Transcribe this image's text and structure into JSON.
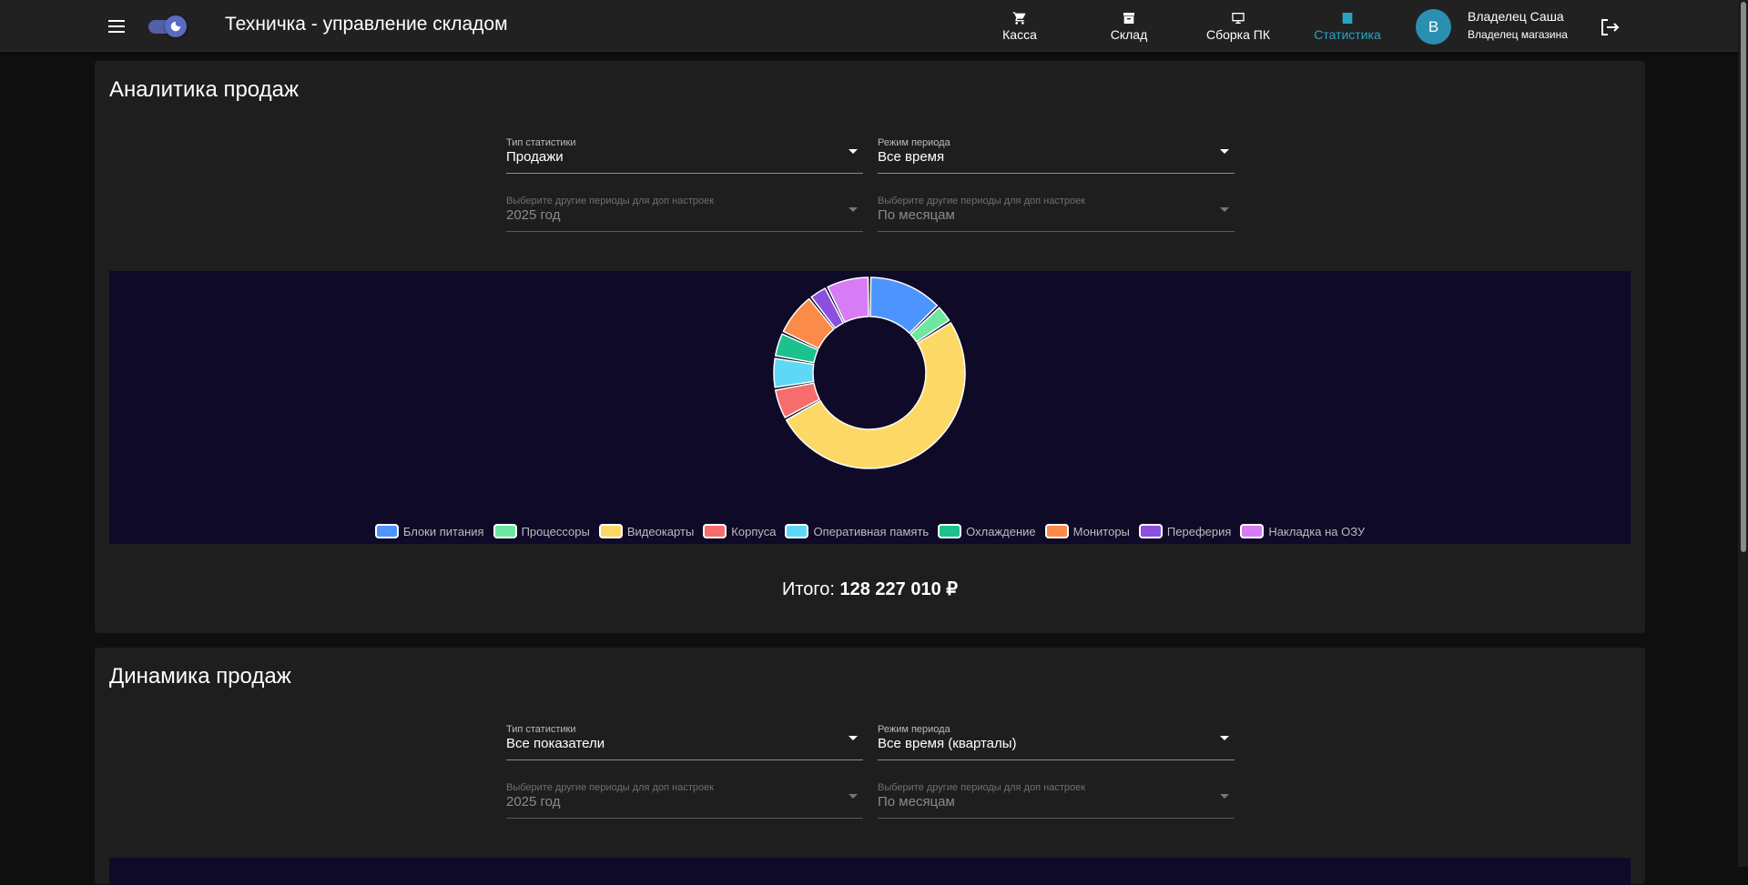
{
  "header": {
    "app_title": "Техничка - управление складом",
    "nav": [
      {
        "label": "Касса",
        "icon": "cart-icon"
      },
      {
        "label": "Склад",
        "icon": "archive-icon"
      },
      {
        "label": "Сборка ПК",
        "icon": "monitor-icon"
      },
      {
        "label": "Статистика",
        "icon": "chart-icon",
        "active": true
      }
    ],
    "user": {
      "initial": "В",
      "name": "Владелец Саша",
      "role": "Владелец магазина"
    },
    "accent_color": "#29a3c5"
  },
  "analytics": {
    "title": "Аналитика продаж",
    "filters": [
      {
        "label": "Тип статистики",
        "value": "Продажи"
      },
      {
        "label": "Режим периода",
        "value": "Все время"
      },
      {
        "label": "Выберите другие периоды для доп настроек",
        "value": "2025 год"
      },
      {
        "label": "Выберите другие периоды для доп настроек",
        "value": "По месяцам"
      }
    ],
    "total_label": "Итого:",
    "total_value": "128 227 010 ₽"
  },
  "dynamics": {
    "title": "Динамика продаж",
    "filters": [
      {
        "label": "Тип статистики",
        "value": "Все показатели"
      },
      {
        "label": "Режим периода",
        "value": "Все время (кварталы)"
      },
      {
        "label": "Выберите другие периоды для доп настроек",
        "value": "2025 год"
      },
      {
        "label": "Выберите другие периоды для доп настроек",
        "value": "По месяцам"
      }
    ]
  },
  "chart_data": {
    "type": "pie",
    "title": "",
    "legend_position": "bottom",
    "categories": [
      "Блоки питания",
      "Процессоры",
      "Видеокарты",
      "Корпуса",
      "Оперативная память",
      "Охлаждение",
      "Мониторы",
      "Переферия",
      "Накладка на ОЗУ"
    ],
    "values": [
      12,
      3,
      48,
      5,
      5,
      4,
      7,
      3,
      7
    ],
    "colors": [
      "#4d94ff",
      "#6ee7a0",
      "#fcd967",
      "#f76c6c",
      "#5dd9f7",
      "#1bc28e",
      "#fb8b48",
      "#8c4fe0",
      "#d77cf5"
    ]
  }
}
